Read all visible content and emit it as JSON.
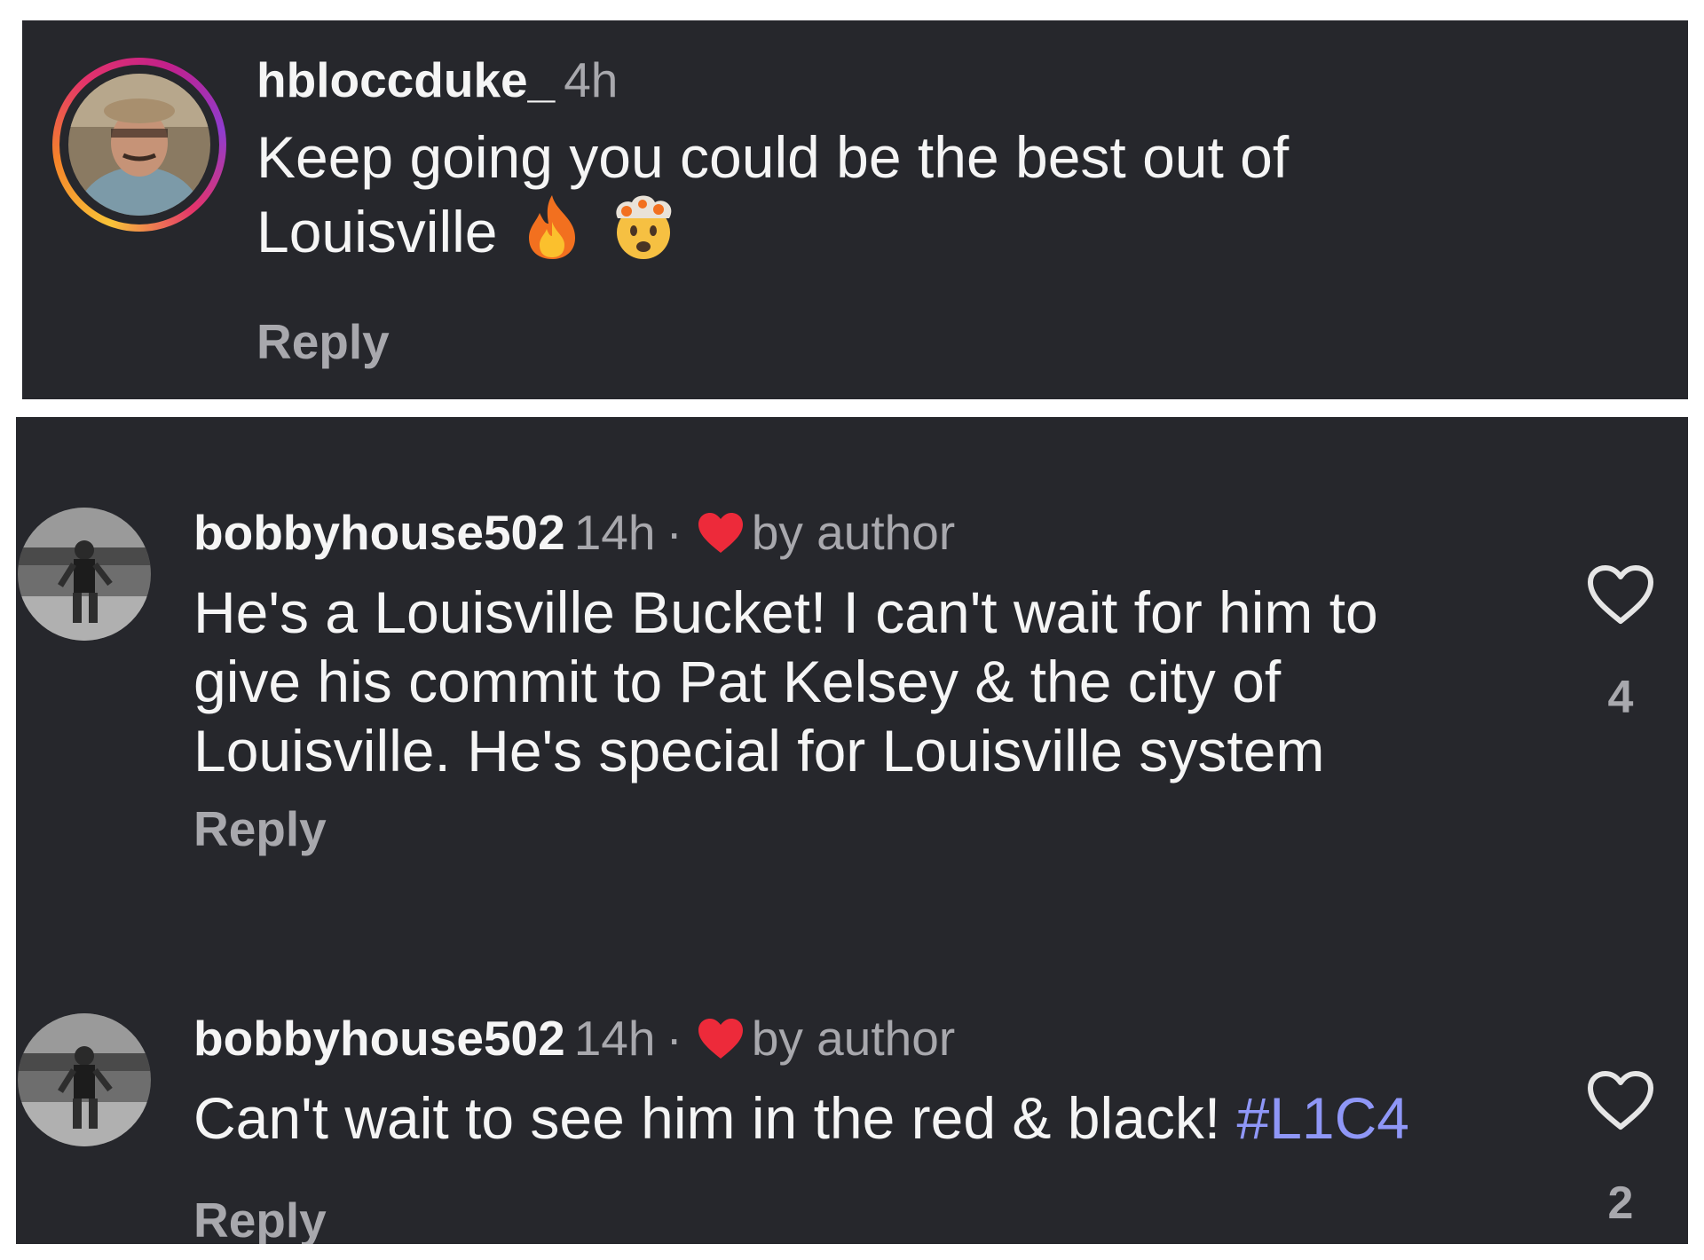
{
  "colors": {
    "background": "#26272c",
    "text_primary": "#f5f5f5",
    "text_secondary": "#a8a8ad",
    "hashtag": "#8f97f7",
    "author_heart": "#ed2a3a"
  },
  "comments": [
    {
      "username": "hbloccduke_",
      "time": "4h",
      "text": "Keep going you could be the best out of\nLouisville",
      "emojis": [
        "fire-emoji",
        "exploding-head-emoji"
      ],
      "reply_label": "Reply",
      "has_story_ring": true
    },
    {
      "username": "bobbyhouse502",
      "time": "14h",
      "separator": "·",
      "author_like_label": "by author",
      "text": "He's a Louisville Bucket! I can't wait for him to\ngive his commit to Pat Kelsey & the city of\nLouisville. He's special for Louisville system",
      "reply_label": "Reply",
      "like_count": "4"
    },
    {
      "username": "bobbyhouse502",
      "time": "14h",
      "separator": "·",
      "author_like_label": "by author",
      "text": "Can't wait to see him in the red & black!",
      "hashtag": "#L1C4",
      "reply_label": "Reply",
      "like_count": "2"
    }
  ]
}
